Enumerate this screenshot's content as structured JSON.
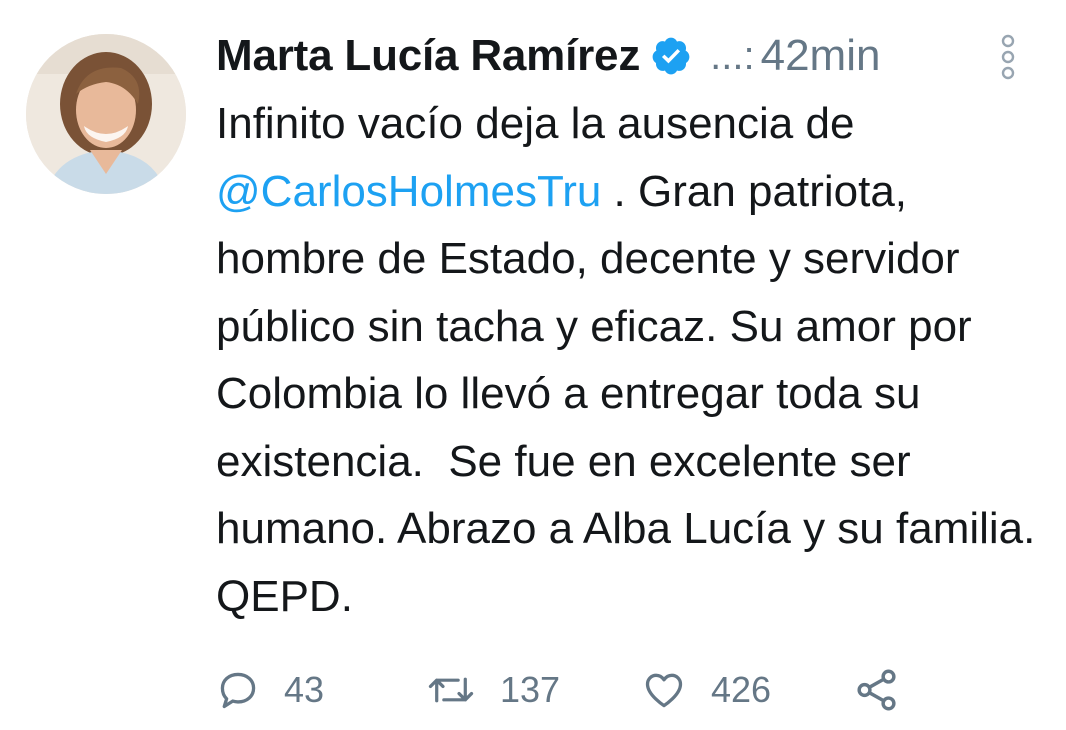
{
  "tweet": {
    "author_name": "Marta Lucía Ramírez",
    "handle": "...:",
    "time": "42min",
    "text_before": "Infinito vacío deja la ausencia de ",
    "mention": "@CarlosHolmesTru",
    "text_after": " . Gran patriota, hombre de Estado, decente y servidor público sin tacha y eficaz. Su amor por Colombia lo llevó a entregar toda su existencia.  Se fue en excelente ser humano. Abrazo a Alba Lucía y su familia.  QEPD."
  },
  "actions": {
    "reply_count": "43",
    "retweet_count": "137",
    "like_count": "426"
  },
  "icons": {
    "verified": "verified-badge-icon",
    "menu": "vertical-dots-icon",
    "reply": "reply-icon",
    "retweet": "retweet-icon",
    "like": "heart-icon",
    "share": "share-icon"
  },
  "colors": {
    "accent": "#1da1f2",
    "text": "#14171a",
    "secondary": "#657786"
  }
}
